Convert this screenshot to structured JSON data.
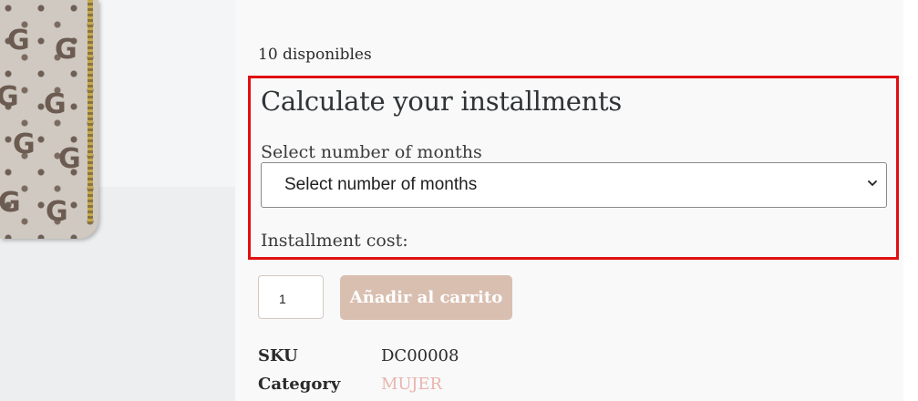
{
  "product": {
    "stock_text": "10 disponibles"
  },
  "installments": {
    "title": "Calculate your installments",
    "months_label": "Select number of months",
    "months_select_value": "Select number of months",
    "cost_label": "Installment cost:"
  },
  "cart": {
    "quantity": "1",
    "add_button_label": "Añadir al carrito"
  },
  "meta": {
    "sku_label": "SKU",
    "sku_value": "DC00008",
    "category_label": "Category",
    "category_value": "MUJER"
  },
  "colors": {
    "highlight_border": "#e01010",
    "button_bg": "#d9bfb0",
    "category_link": "#e8b5ad"
  },
  "icons": {
    "select_arrow": "chevron-down-icon"
  }
}
